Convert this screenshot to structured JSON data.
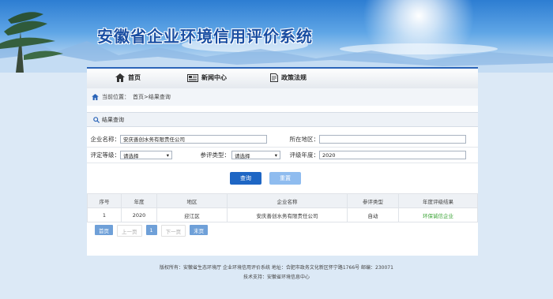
{
  "header": {
    "title": "安徽省企业环境信用评价系统"
  },
  "nav": {
    "items": [
      {
        "label": "首页",
        "icon": "home-icon"
      },
      {
        "label": "新闻中心",
        "icon": "news-icon"
      },
      {
        "label": "政策法规",
        "icon": "document-icon"
      }
    ]
  },
  "breadcrumb": {
    "prefix": "当前位置：",
    "path": "首页>结果查询"
  },
  "section": {
    "title": "结果查询"
  },
  "form": {
    "company_label": "企业名称：",
    "company_value": "安庆善创水务有限责任公司",
    "region_label": "所在地区：",
    "region_value": "",
    "rating_label": "评定等级：",
    "rating_value": "请选择",
    "type_label": "参评类型：",
    "type_value": "请选择",
    "year_label": "评级年度：",
    "year_value": "2020"
  },
  "buttons": {
    "query": "查询",
    "reset": "重置"
  },
  "table": {
    "headers": [
      "序号",
      "年度",
      "地区",
      "企业名称",
      "参评类型",
      "年度评级结果"
    ],
    "rows": [
      {
        "no": "1",
        "year": "2020",
        "region": "迎江区",
        "company": "安庆善创水务有限责任公司",
        "type": "自动",
        "result": "环保诚信企业"
      }
    ]
  },
  "pager": {
    "first": "首页",
    "prev": "上一页",
    "current": "1",
    "next": "下一页",
    "last": "末页"
  },
  "footer": {
    "line1": "版权所有：安徽省生态环境厅 企业环境信用评价系统 地址：合肥市政务文化新区怀宁路1766号 邮编：230071",
    "line2": "技术支持：安徽省环境信息中心"
  },
  "colors": {
    "primary": "#2a64b8",
    "query_button": "#1e66c4",
    "reset_button": "#8fbcef",
    "result_text": "#3aa335"
  }
}
